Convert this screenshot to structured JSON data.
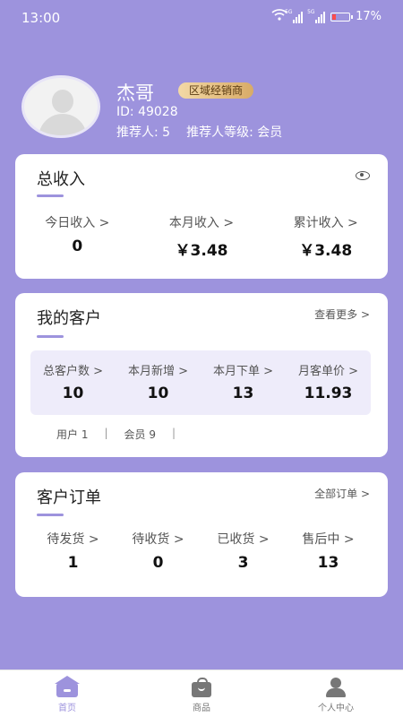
{
  "status_bar": {
    "time": "13:00",
    "signal1_tag": "5G",
    "signal2_tag": "5G",
    "battery": "17%"
  },
  "profile": {
    "name": "杰哥",
    "role_badge": "区域经销商",
    "id_line": "ID:   49028",
    "referrer": "推荐人: 5",
    "referrer_level": "推荐人等级: 会员"
  },
  "income": {
    "title": "总收入",
    "items": [
      {
        "label": "今日收入 >",
        "value": "0"
      },
      {
        "label": "本月收入 >",
        "value": "￥3.48"
      },
      {
        "label": "累计收入 >",
        "value": "￥3.48"
      }
    ]
  },
  "customers": {
    "title": "我的客户",
    "more_link": "查看更多 >",
    "stats": [
      {
        "label": "总客户数 >",
        "value": "10"
      },
      {
        "label": "本月新增 >",
        "value": "10"
      },
      {
        "label": "本月下单 >",
        "value": "13"
      },
      {
        "label": "月客单价 >",
        "value": "11.93"
      }
    ],
    "users_label": "用户 1",
    "members_label": "会员 9",
    "separator": "|"
  },
  "orders": {
    "title": "客户订单",
    "all_link": "全部订单 >",
    "items": [
      {
        "label": "待发货 >",
        "value": "1"
      },
      {
        "label": "待收货 >",
        "value": "0"
      },
      {
        "label": "已收货 >",
        "value": "3"
      },
      {
        "label": "售后中 >",
        "value": "13"
      }
    ]
  },
  "tabbar": {
    "tabs": [
      {
        "label": "首页",
        "icon": "home-icon",
        "active": true
      },
      {
        "label": "商品",
        "icon": "shopping-bag-icon",
        "active": false
      },
      {
        "label": "个人中心",
        "icon": "user-icon",
        "active": false
      }
    ]
  },
  "colors": {
    "accent": "#9d93dd",
    "card": "#ffffff",
    "stat_bg": "#eeecfa",
    "badge_gold": "#d8ab67",
    "battery_low": "#ff4d4d"
  }
}
